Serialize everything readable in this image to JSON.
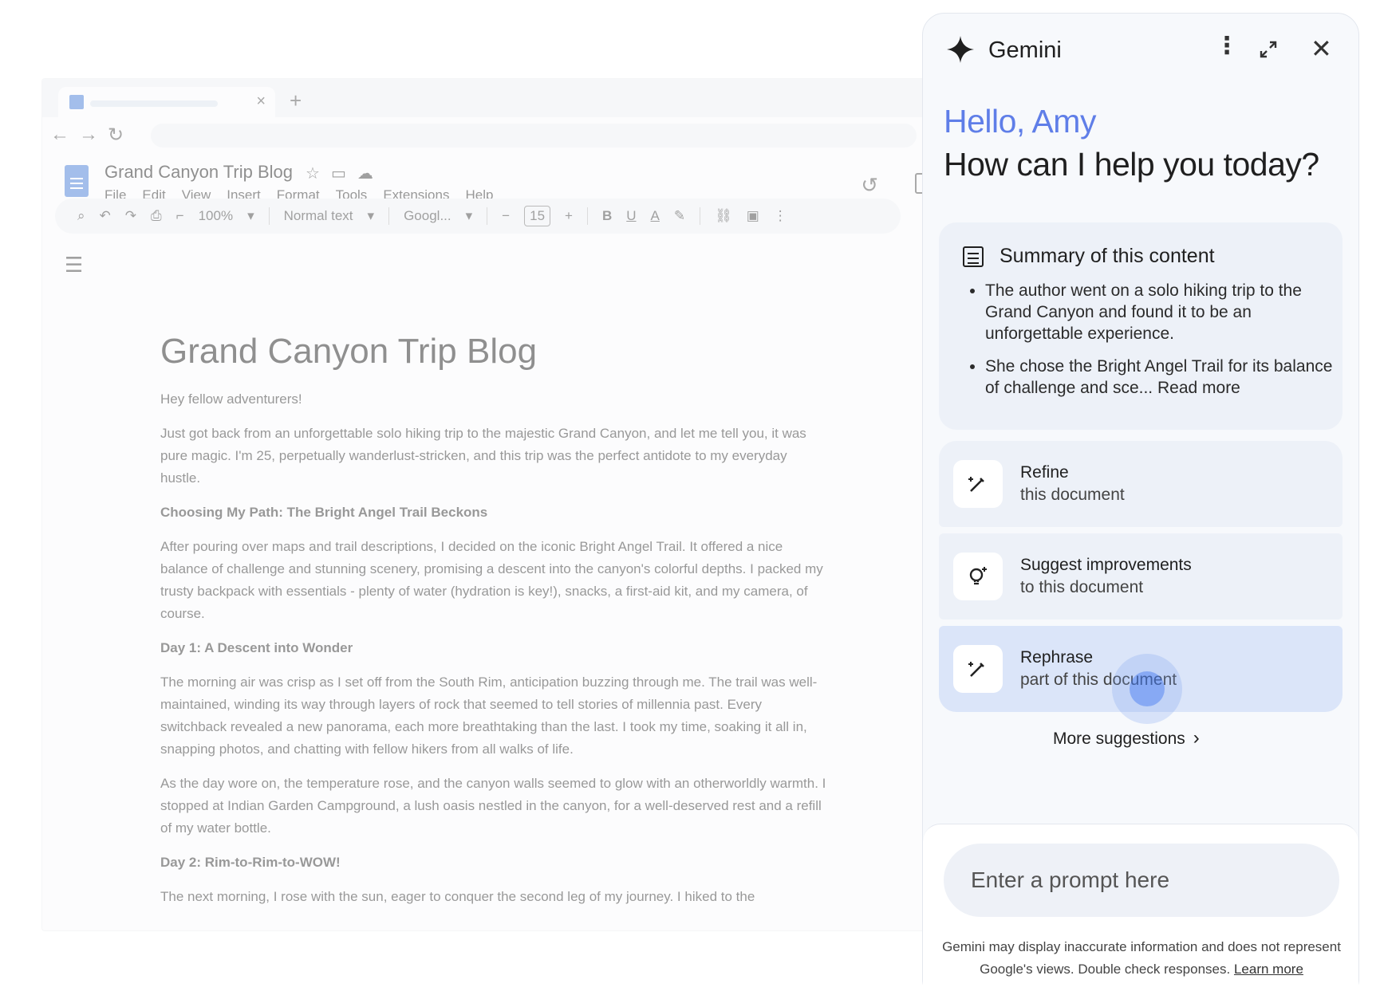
{
  "doc": {
    "window_title": "Grand Canyon Trip Blog",
    "menu": [
      "File",
      "Edit",
      "View",
      "Insert",
      "Format",
      "Tools",
      "Extensions",
      "Help"
    ],
    "toolbar": {
      "zoom": "100%",
      "style": "Normal text",
      "font": "Googl...",
      "font_size": "15",
      "bold": "B",
      "underline": "U",
      "text_color": "A"
    },
    "heading": "Grand Canyon Trip Blog",
    "paragraphs": [
      {
        "type": "p",
        "text": "Hey fellow adventurers!"
      },
      {
        "type": "p",
        "text": "Just got back from an unforgettable solo hiking trip to the majestic Grand Canyon, and let me tell you, it was pure magic. I'm 25, perpetually wanderlust-stricken, and this trip was the perfect antidote to my everyday hustle."
      },
      {
        "type": "h3",
        "text": "Choosing My Path: The Bright Angel Trail Beckons"
      },
      {
        "type": "p",
        "text": "After pouring over maps and trail descriptions, I decided on the iconic Bright Angel Trail. It offered a nice balance of challenge and stunning scenery, promising a descent into the canyon's colorful depths. I packed my trusty backpack with essentials - plenty of water (hydration is key!), snacks, a first-aid kit, and my camera, of course."
      },
      {
        "type": "h3",
        "text": "Day 1: A Descent into Wonder"
      },
      {
        "type": "p",
        "text": "The morning air was crisp as I set off from the South Rim, anticipation buzzing through me. The trail was well-maintained, winding its way through layers of rock that seemed to tell stories of millennia past. Every switchback revealed a new panorama, each more breathtaking than the last. I took my time, soaking it all in, snapping photos, and chatting with fellow hikers from all walks of life."
      },
      {
        "type": "p",
        "text": "As the day wore on, the temperature rose, and the canyon walls seemed to glow with an otherworldly warmth. I stopped at Indian Garden Campground, a lush oasis nestled in the canyon, for a well-deserved rest and a refill of my water bottle."
      },
      {
        "type": "h3",
        "text": "Day 2: Rim-to-Rim-to-WOW!"
      },
      {
        "type": "p",
        "text": "The next morning, I rose with the sun, eager to conquer the second leg of my journey. I hiked to the"
      }
    ]
  },
  "gemini": {
    "title": "Gemini",
    "greeting": "Hello, Amy",
    "help_text": "How can I help you today?",
    "summary": {
      "title": "Summary of this content",
      "bullets": [
        "The author went on a solo hiking trip to the Grand Canyon and found it to be an unforgettable experience.",
        "She chose the Bright Angel Trail for its balance of challenge and sce... Read more"
      ]
    },
    "suggestions": [
      {
        "title": "Refine",
        "subtitle": "this document",
        "icon": "magic-pencil-icon"
      },
      {
        "title": "Suggest improvements",
        "subtitle": "to this document",
        "icon": "lightbulb-sparkle-icon"
      },
      {
        "title": "Rephrase",
        "subtitle": "part of this document",
        "icon": "magic-pencil-icon"
      }
    ],
    "more_suggestions": "More suggestions",
    "prompt_placeholder": "Enter a prompt here",
    "disclaimer": "Gemini may display inaccurate information and does not represent Google's views. Double check responses.",
    "learn_more": "Learn more"
  },
  "colors": {
    "greeting": "#5f7ee8",
    "selected_suggestion": "#dbe5f9",
    "card_bg": "#edf1f8"
  }
}
